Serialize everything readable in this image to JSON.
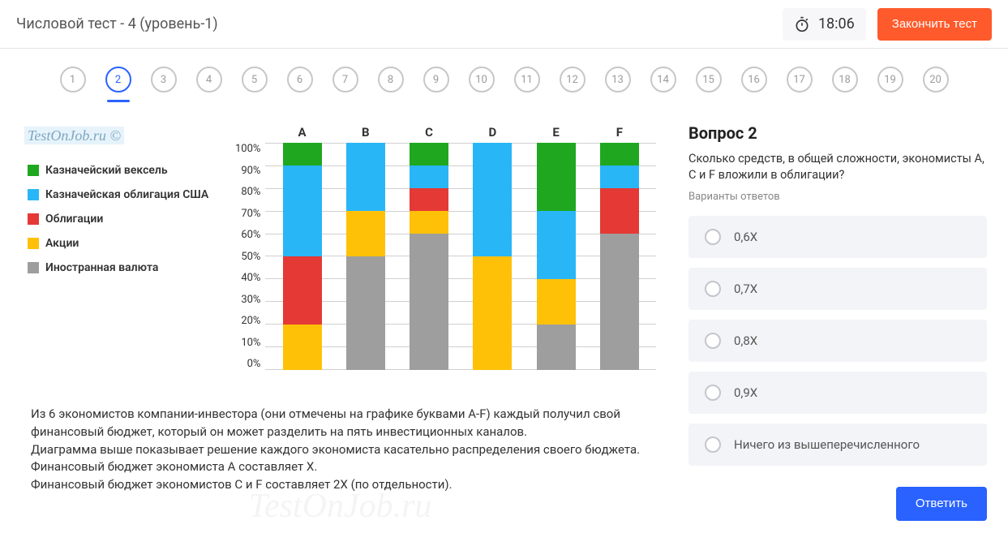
{
  "header": {
    "title": "Числовой тест - 4 (уровень-1)",
    "timer": "18:06",
    "finish": "Закончить тест"
  },
  "nav": {
    "items": [
      "1",
      "2",
      "3",
      "4",
      "5",
      "6",
      "7",
      "8",
      "9",
      "10",
      "11",
      "12",
      "13",
      "14",
      "15",
      "16",
      "17",
      "18",
      "19",
      "20"
    ],
    "current": 2
  },
  "watermark": "TestOnJob.ru ©",
  "bg_watermark": "TestOnJob.ru",
  "legend": [
    {
      "label": "Казначейский вексель",
      "color": "#1fa81f"
    },
    {
      "label": "Казначейская облигация США",
      "color": "#29b6f6"
    },
    {
      "label": "Облигации",
      "color": "#e53935"
    },
    {
      "label": "Акции",
      "color": "#ffc107"
    },
    {
      "label": "Иностранная валюта",
      "color": "#9e9e9e"
    }
  ],
  "y_ticks": [
    "100%",
    "90%",
    "80%",
    "70%",
    "60%",
    "50%",
    "40%",
    "30%",
    "20%",
    "10%",
    "0%"
  ],
  "chart_data": {
    "type": "bar",
    "stacked": true,
    "categories": [
      "A",
      "B",
      "C",
      "D",
      "E",
      "F"
    ],
    "series": [
      {
        "name": "Иностранная валюта",
        "color": "#9e9e9e",
        "values": [
          0,
          50,
          60,
          0,
          20,
          60
        ]
      },
      {
        "name": "Акции",
        "color": "#ffc107",
        "values": [
          20,
          20,
          10,
          50,
          20,
          0
        ]
      },
      {
        "name": "Облигации",
        "color": "#e53935",
        "values": [
          30,
          0,
          10,
          0,
          0,
          20
        ]
      },
      {
        "name": "Казначейская облигация США",
        "color": "#29b6f6",
        "values": [
          40,
          30,
          10,
          50,
          30,
          10
        ]
      },
      {
        "name": "Казначейский вексель",
        "color": "#1fa81f",
        "values": [
          10,
          0,
          10,
          0,
          30,
          10
        ]
      }
    ],
    "ylabel": "%",
    "ylim": [
      0,
      100
    ],
    "title": ""
  },
  "description": "Из 6 экономистов компании-инвестора (они отмечены на графике буквами A-F) каждый получил свой финансовый бюджет, который он может разделить на пять инвестиционных каналов.\nДиаграмма выше показывает решение каждого экономиста касательно распределения своего бюджета.\nФинансовый бюджет экономиста A составляет X.\nФинансовый бюджет экономистов C и F составляет 2X  (по отдельности).",
  "question": {
    "title": "Вопрос 2",
    "text": "Сколько средств, в общей сложности, экономисты A, C и F вложили в облигации?",
    "subtitle": "Варианты ответов",
    "options": [
      "0,6X",
      "0,7X",
      "0,8X",
      "0,9X",
      "Ничего из вышеперечисленного"
    ],
    "answer_btn": "Ответить"
  }
}
